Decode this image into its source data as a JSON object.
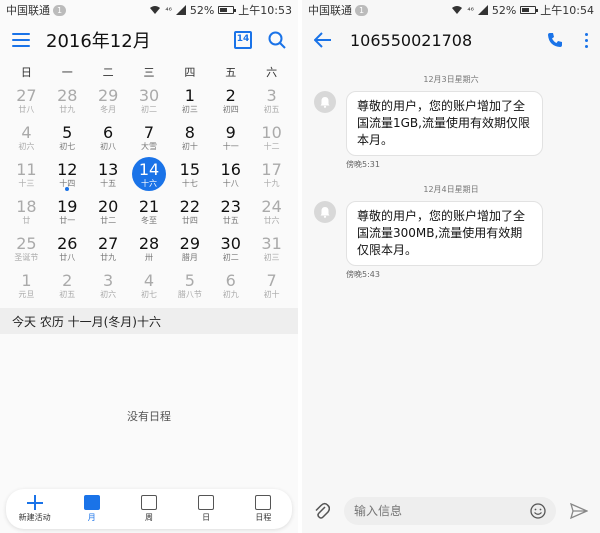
{
  "status_left": {
    "carrier": "中国联通",
    "sim": "1",
    "battery": "52%",
    "time": "上午10:53",
    "signal": "⁴⁶"
  },
  "status_right": {
    "carrier": "中国联通",
    "sim": "1",
    "battery": "52%",
    "time": "上午10:54",
    "signal": "⁴⁶"
  },
  "calendar": {
    "title": "2016年12月",
    "today_icon_label": "14",
    "weekdays": [
      "日",
      "一",
      "二",
      "三",
      "四",
      "五",
      "六"
    ],
    "weeks": [
      [
        {
          "n": "27",
          "l": "廿八",
          "m": true
        },
        {
          "n": "28",
          "l": "廿九",
          "m": true
        },
        {
          "n": "29",
          "l": "冬月",
          "m": true
        },
        {
          "n": "30",
          "l": "初二",
          "m": true
        },
        {
          "n": "1",
          "l": "初三"
        },
        {
          "n": "2",
          "l": "初四"
        },
        {
          "n": "3",
          "l": "初五",
          "m": true
        }
      ],
      [
        {
          "n": "4",
          "l": "初六",
          "m": true
        },
        {
          "n": "5",
          "l": "初七"
        },
        {
          "n": "6",
          "l": "初八"
        },
        {
          "n": "7",
          "l": "大雪"
        },
        {
          "n": "8",
          "l": "初十"
        },
        {
          "n": "9",
          "l": "十一"
        },
        {
          "n": "10",
          "l": "十二",
          "m": true
        }
      ],
      [
        {
          "n": "11",
          "l": "十三",
          "m": true
        },
        {
          "n": "12",
          "l": "十四",
          "dot": true
        },
        {
          "n": "13",
          "l": "十五"
        },
        {
          "n": "14",
          "l": "十六",
          "sel": true
        },
        {
          "n": "15",
          "l": "十七"
        },
        {
          "n": "16",
          "l": "十八"
        },
        {
          "n": "17",
          "l": "十九",
          "m": true
        }
      ],
      [
        {
          "n": "18",
          "l": "廿",
          "m": true
        },
        {
          "n": "19",
          "l": "廿一"
        },
        {
          "n": "20",
          "l": "廿二"
        },
        {
          "n": "21",
          "l": "冬至"
        },
        {
          "n": "22",
          "l": "廿四"
        },
        {
          "n": "23",
          "l": "廿五"
        },
        {
          "n": "24",
          "l": "廿六",
          "m": true
        }
      ],
      [
        {
          "n": "25",
          "l": "圣诞节",
          "m": true
        },
        {
          "n": "26",
          "l": "廿八"
        },
        {
          "n": "27",
          "l": "廿九"
        },
        {
          "n": "28",
          "l": "卅"
        },
        {
          "n": "29",
          "l": "腊月"
        },
        {
          "n": "30",
          "l": "初二"
        },
        {
          "n": "31",
          "l": "初三",
          "m": true
        }
      ],
      [
        {
          "n": "1",
          "l": "元旦",
          "m": true
        },
        {
          "n": "2",
          "l": "初五",
          "m": true
        },
        {
          "n": "3",
          "l": "初六",
          "m": true
        },
        {
          "n": "4",
          "l": "初七",
          "m": true
        },
        {
          "n": "5",
          "l": "腊八节",
          "m": true
        },
        {
          "n": "6",
          "l": "初九",
          "m": true
        },
        {
          "n": "7",
          "l": "初十",
          "m": true
        }
      ]
    ],
    "info_strip": "今天  农历 十一月(冬月)十六",
    "empty_text": "没有日程",
    "nav": [
      {
        "label": "新建活动",
        "icon": "plus-icon"
      },
      {
        "label": "月",
        "icon": "month-icon",
        "active": true
      },
      {
        "label": "周",
        "icon": "week-icon"
      },
      {
        "label": "日",
        "icon": "day-icon"
      },
      {
        "label": "日程",
        "icon": "agenda-icon"
      }
    ]
  },
  "messages": {
    "title": "106550021708",
    "items": [
      {
        "date": "12月3日星期六",
        "text": "尊敬的用户，您的账户增加了全国流量1GB,流量使用有效期仅限本月。",
        "time": "傍晚5:31"
      },
      {
        "date": "12月4日星期日",
        "text": "尊敬的用户，您的账户增加了全国流量300MB,流量使用有效期仅限本月。",
        "time": "傍晚5:43"
      }
    ],
    "input_placeholder": "输入信息"
  },
  "colors": {
    "accent": "#1a73e8"
  }
}
